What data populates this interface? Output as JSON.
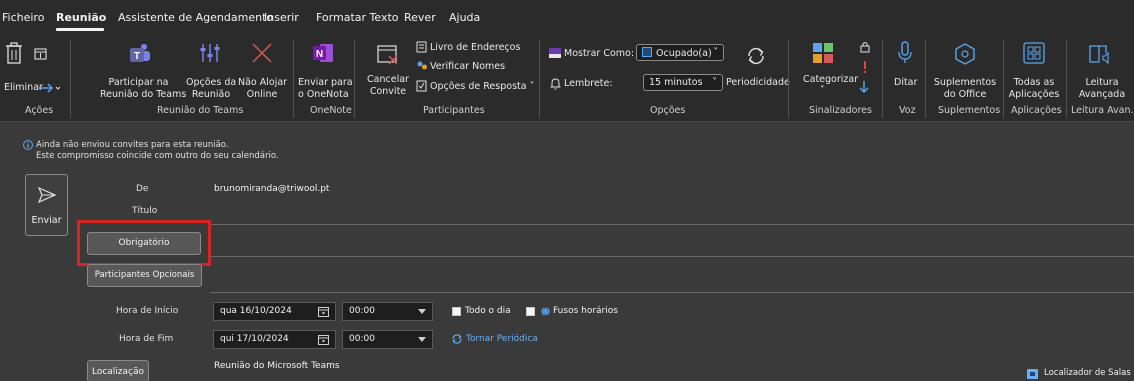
{
  "tabs": [
    {
      "label": "Ficheiro",
      "active": false
    },
    {
      "label": "Reunião",
      "active": true
    },
    {
      "label": "Assistente de Agendamento",
      "active": false
    },
    {
      "label": "Inserir",
      "active": false
    },
    {
      "label": "Formatar Texto",
      "active": false
    },
    {
      "label": "Rever",
      "active": false
    },
    {
      "label": "Ajuda",
      "active": false
    }
  ],
  "ribbon": {
    "acoes": {
      "group": "Ações",
      "eliminar": "Eliminar"
    },
    "teams": {
      "group": "Reunião do Teams",
      "participar_l1": "Participar na",
      "participar_l2": "Reunião do Teams",
      "opcoes_l1": "Opções da",
      "opcoes_l2": "Reunião",
      "nao_alojar_l1": "Não Alojar",
      "nao_alojar_l2": "Online"
    },
    "onenote": {
      "group": "OneNote",
      "enviar_l1": "Enviar para",
      "enviar_l2": "o OneNota"
    },
    "participantes": {
      "group": "Participantes",
      "cancelar_l1": "Cancelar",
      "cancelar_l2": "Convite",
      "livro": "Livro de Endereços",
      "verificar": "Verificar Nomes",
      "opcoes_resposta": "Opções de Resposta ˅"
    },
    "opcoes": {
      "group": "Opções",
      "mostrar_como": "Mostrar Como:",
      "mostrar_value": "Ocupado(a)",
      "lembrete": "Lembrete:",
      "lembrete_value": "15 minutos",
      "periodicidade": "Periodicidade"
    },
    "sinalizadores": {
      "group": "Sinalizadores",
      "categorizar": "Categorizar"
    },
    "voz": {
      "group": "Voz",
      "ditar": "Ditar"
    },
    "suplementos": {
      "group": "Suplementos",
      "l1": "Suplementos",
      "l2": "do Office"
    },
    "aplicacoes": {
      "group": "Aplicações",
      "l1": "Todas as",
      "l2": "Aplicações"
    },
    "leitura": {
      "group": "Leitura Avan...",
      "l1": "Leitura",
      "l2": "Avançada"
    }
  },
  "info": {
    "line1": "Ainda não enviou convites para esta reunião.",
    "line2": "Este compromisso coincide com outro do seu calendário."
  },
  "form": {
    "enviar": "Enviar",
    "de_label": "De",
    "de_value": "brunomiranda@triwool.pt",
    "titulo_label": "Título",
    "obrigatorio": "Obrigatório",
    "opcionais": "Participantes Opcionais",
    "inicio_label": "Hora de Início",
    "inicio_date": "qua 16/10/2024",
    "inicio_time": "00:00",
    "fim_label": "Hora de Fim",
    "fim_date": "qui 17/10/2024",
    "fim_time": "00:00",
    "todo_dia": "Todo o dia",
    "fusos": "Fusos horários",
    "tornar_periodica": "Tornar Periódica",
    "localizacao": "Localização",
    "localizacao_value": "Reunião do Microsoft Teams",
    "localizador_salas": "Localizador de Salas"
  },
  "colors": {
    "highlight": "#d92323",
    "accent": "#6aaef5",
    "teams": "#6264a7",
    "onenote": "#7719aa"
  }
}
